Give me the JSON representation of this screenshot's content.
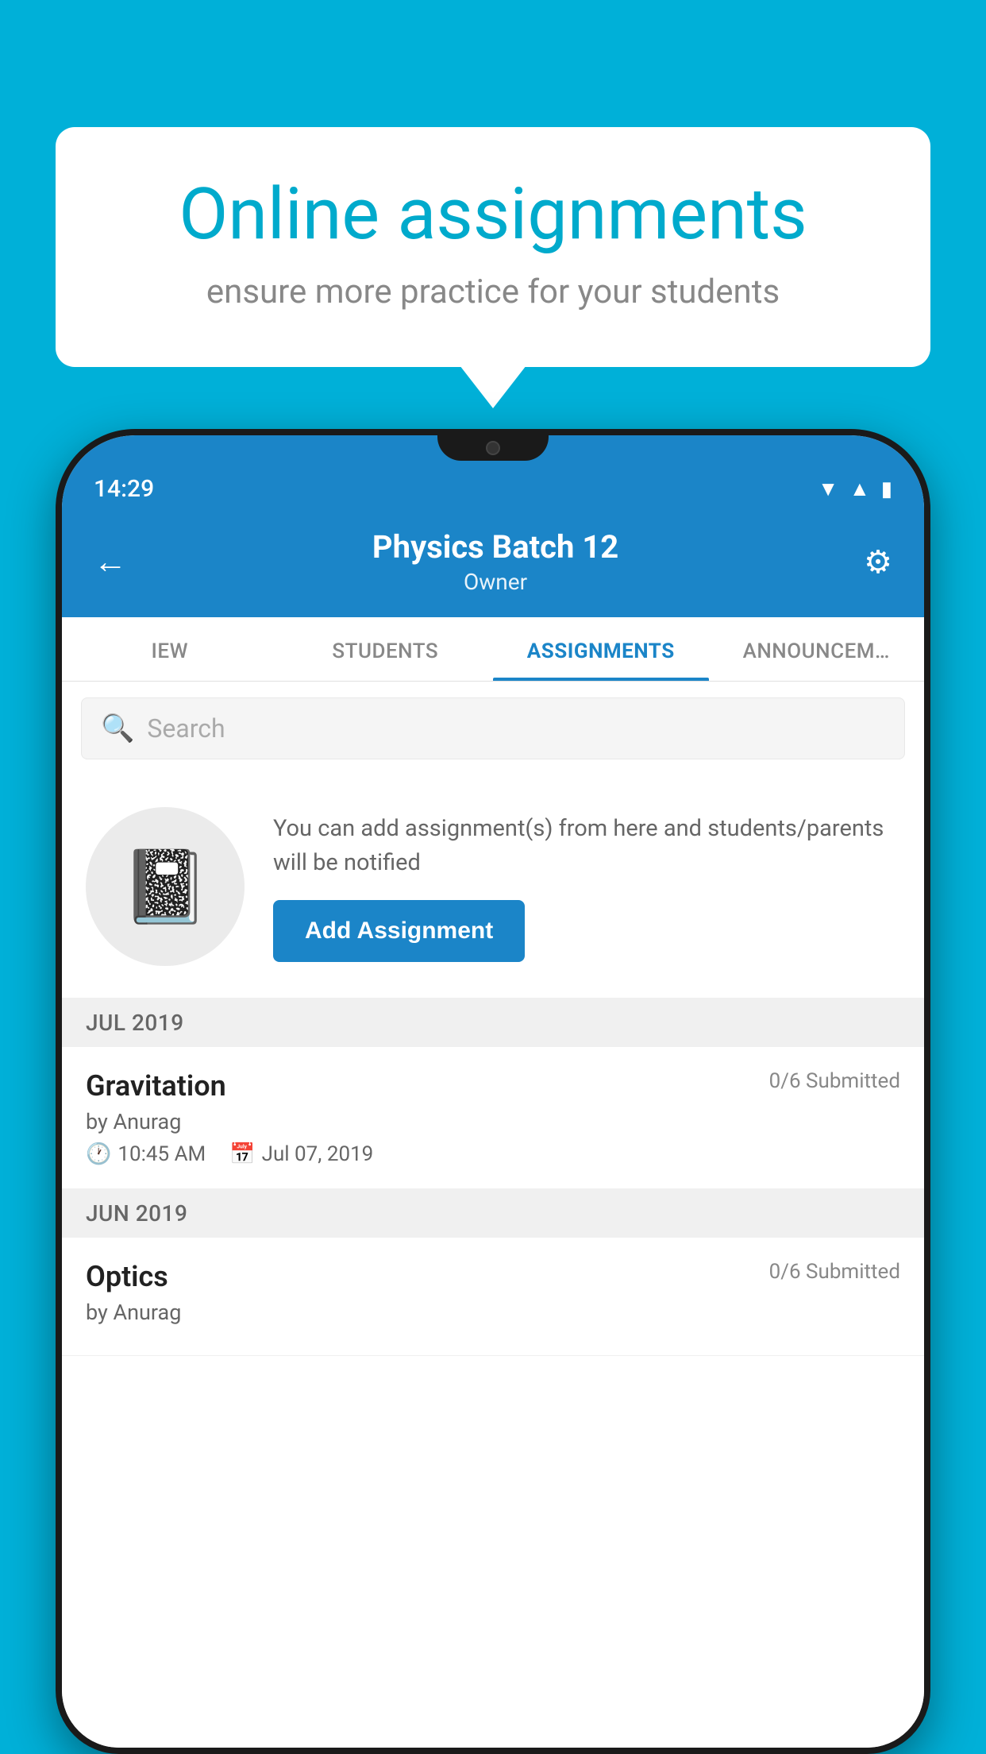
{
  "background": {
    "color": "#00B0D8"
  },
  "speech_bubble": {
    "title": "Online assignments",
    "subtitle": "ensure more practice for your students"
  },
  "phone": {
    "status_bar": {
      "time": "14:29",
      "icons": [
        "wifi",
        "signal",
        "battery"
      ]
    },
    "header": {
      "title": "Physics Batch 12",
      "subtitle": "Owner",
      "back_label": "←",
      "settings_label": "⚙"
    },
    "tabs": [
      {
        "label": "IEW",
        "active": false
      },
      {
        "label": "STUDENTS",
        "active": false
      },
      {
        "label": "ASSIGNMENTS",
        "active": true
      },
      {
        "label": "ANNOUNCEM…",
        "active": false
      }
    ],
    "search": {
      "placeholder": "Search"
    },
    "add_assignment": {
      "description": "You can add assignment(s) from here and students/parents will be notified",
      "button_label": "Add Assignment"
    },
    "sections": [
      {
        "header": "JUL 2019",
        "assignments": [
          {
            "name": "Gravitation",
            "submitted": "0/6 Submitted",
            "author": "by Anurag",
            "time": "10:45 AM",
            "date": "Jul 07, 2019"
          }
        ]
      },
      {
        "header": "JUN 2019",
        "assignments": [
          {
            "name": "Optics",
            "submitted": "0/6 Submitted",
            "author": "by Anurag",
            "time": "",
            "date": ""
          }
        ]
      }
    ]
  }
}
